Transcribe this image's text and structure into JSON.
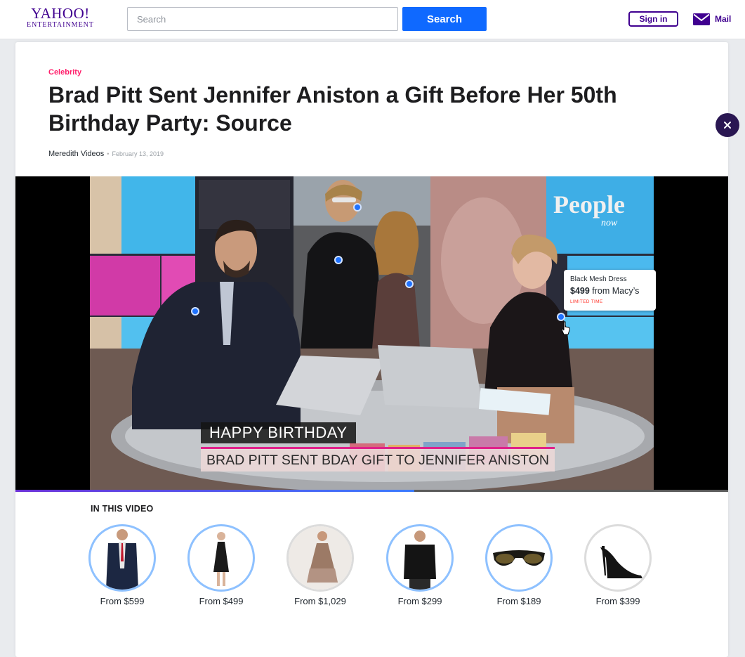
{
  "header": {
    "logo_main": "YAHOO!",
    "logo_sub": "ENTERTAINMENT",
    "search_placeholder": "Search",
    "search_button": "Search",
    "sign_in": "Sign in",
    "mail": "Mail",
    "brand_color": "#400090",
    "search_button_color": "#0f69ff"
  },
  "article": {
    "category": "Celebrity",
    "category_color": "#ff1f6b",
    "headline": "Brad Pitt Sent Jennifer Aniston a Gift Before Her 50th Birthday Party: Source",
    "author": "Meredith Videos",
    "date": "February 13, 2019"
  },
  "video": {
    "channel_logo": "People now",
    "caption_top": "HAPPY BIRTHDAY",
    "caption_bottom": "BRAD PITT SENT BDAY GIFT TO JENNIFER ANISTON",
    "progress_fraction": 0.56,
    "tooltip": {
      "product_name": "Black Mesh Dress",
      "price": "$499",
      "retailer": "from Macy’s",
      "badge": "LIMITED TIME"
    }
  },
  "products": {
    "heading": "IN THIS VIDEO",
    "items": [
      {
        "icon": "suit-icon",
        "price": "From $599"
      },
      {
        "icon": "black-dress-icon",
        "price": "From $499"
      },
      {
        "icon": "sequin-dress-icon",
        "price": "From $1,029"
      },
      {
        "icon": "black-shirt-icon",
        "price": "From $299"
      },
      {
        "icon": "sunglasses-icon",
        "price": "From $189"
      },
      {
        "icon": "high-heel-icon",
        "price": "From $399"
      }
    ]
  }
}
